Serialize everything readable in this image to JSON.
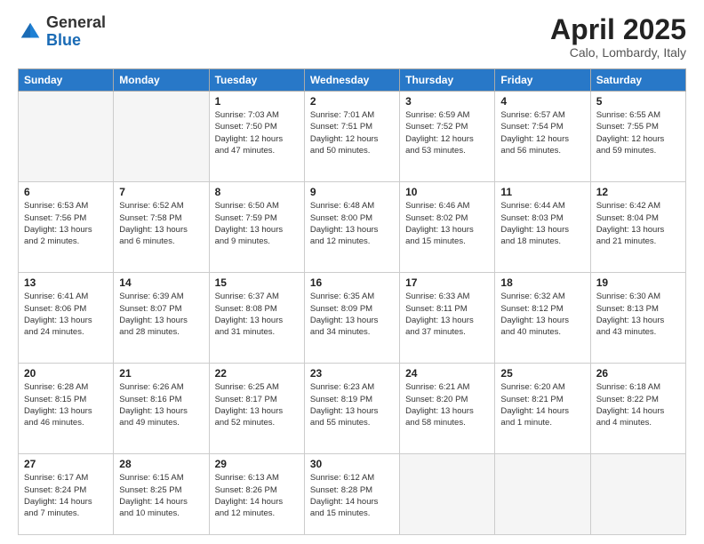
{
  "header": {
    "logo_general": "General",
    "logo_blue": "Blue",
    "title": "April 2025",
    "subtitle": "Calo, Lombardy, Italy"
  },
  "days_of_week": [
    "Sunday",
    "Monday",
    "Tuesday",
    "Wednesday",
    "Thursday",
    "Friday",
    "Saturday"
  ],
  "weeks": [
    [
      {
        "day": "",
        "info": ""
      },
      {
        "day": "",
        "info": ""
      },
      {
        "day": "1",
        "info": "Sunrise: 7:03 AM\nSunset: 7:50 PM\nDaylight: 12 hours and 47 minutes."
      },
      {
        "day": "2",
        "info": "Sunrise: 7:01 AM\nSunset: 7:51 PM\nDaylight: 12 hours and 50 minutes."
      },
      {
        "day": "3",
        "info": "Sunrise: 6:59 AM\nSunset: 7:52 PM\nDaylight: 12 hours and 53 minutes."
      },
      {
        "day": "4",
        "info": "Sunrise: 6:57 AM\nSunset: 7:54 PM\nDaylight: 12 hours and 56 minutes."
      },
      {
        "day": "5",
        "info": "Sunrise: 6:55 AM\nSunset: 7:55 PM\nDaylight: 12 hours and 59 minutes."
      }
    ],
    [
      {
        "day": "6",
        "info": "Sunrise: 6:53 AM\nSunset: 7:56 PM\nDaylight: 13 hours and 2 minutes."
      },
      {
        "day": "7",
        "info": "Sunrise: 6:52 AM\nSunset: 7:58 PM\nDaylight: 13 hours and 6 minutes."
      },
      {
        "day": "8",
        "info": "Sunrise: 6:50 AM\nSunset: 7:59 PM\nDaylight: 13 hours and 9 minutes."
      },
      {
        "day": "9",
        "info": "Sunrise: 6:48 AM\nSunset: 8:00 PM\nDaylight: 13 hours and 12 minutes."
      },
      {
        "day": "10",
        "info": "Sunrise: 6:46 AM\nSunset: 8:02 PM\nDaylight: 13 hours and 15 minutes."
      },
      {
        "day": "11",
        "info": "Sunrise: 6:44 AM\nSunset: 8:03 PM\nDaylight: 13 hours and 18 minutes."
      },
      {
        "day": "12",
        "info": "Sunrise: 6:42 AM\nSunset: 8:04 PM\nDaylight: 13 hours and 21 minutes."
      }
    ],
    [
      {
        "day": "13",
        "info": "Sunrise: 6:41 AM\nSunset: 8:06 PM\nDaylight: 13 hours and 24 minutes."
      },
      {
        "day": "14",
        "info": "Sunrise: 6:39 AM\nSunset: 8:07 PM\nDaylight: 13 hours and 28 minutes."
      },
      {
        "day": "15",
        "info": "Sunrise: 6:37 AM\nSunset: 8:08 PM\nDaylight: 13 hours and 31 minutes."
      },
      {
        "day": "16",
        "info": "Sunrise: 6:35 AM\nSunset: 8:09 PM\nDaylight: 13 hours and 34 minutes."
      },
      {
        "day": "17",
        "info": "Sunrise: 6:33 AM\nSunset: 8:11 PM\nDaylight: 13 hours and 37 minutes."
      },
      {
        "day": "18",
        "info": "Sunrise: 6:32 AM\nSunset: 8:12 PM\nDaylight: 13 hours and 40 minutes."
      },
      {
        "day": "19",
        "info": "Sunrise: 6:30 AM\nSunset: 8:13 PM\nDaylight: 13 hours and 43 minutes."
      }
    ],
    [
      {
        "day": "20",
        "info": "Sunrise: 6:28 AM\nSunset: 8:15 PM\nDaylight: 13 hours and 46 minutes."
      },
      {
        "day": "21",
        "info": "Sunrise: 6:26 AM\nSunset: 8:16 PM\nDaylight: 13 hours and 49 minutes."
      },
      {
        "day": "22",
        "info": "Sunrise: 6:25 AM\nSunset: 8:17 PM\nDaylight: 13 hours and 52 minutes."
      },
      {
        "day": "23",
        "info": "Sunrise: 6:23 AM\nSunset: 8:19 PM\nDaylight: 13 hours and 55 minutes."
      },
      {
        "day": "24",
        "info": "Sunrise: 6:21 AM\nSunset: 8:20 PM\nDaylight: 13 hours and 58 minutes."
      },
      {
        "day": "25",
        "info": "Sunrise: 6:20 AM\nSunset: 8:21 PM\nDaylight: 14 hours and 1 minute."
      },
      {
        "day": "26",
        "info": "Sunrise: 6:18 AM\nSunset: 8:22 PM\nDaylight: 14 hours and 4 minutes."
      }
    ],
    [
      {
        "day": "27",
        "info": "Sunrise: 6:17 AM\nSunset: 8:24 PM\nDaylight: 14 hours and 7 minutes."
      },
      {
        "day": "28",
        "info": "Sunrise: 6:15 AM\nSunset: 8:25 PM\nDaylight: 14 hours and 10 minutes."
      },
      {
        "day": "29",
        "info": "Sunrise: 6:13 AM\nSunset: 8:26 PM\nDaylight: 14 hours and 12 minutes."
      },
      {
        "day": "30",
        "info": "Sunrise: 6:12 AM\nSunset: 8:28 PM\nDaylight: 14 hours and 15 minutes."
      },
      {
        "day": "",
        "info": ""
      },
      {
        "day": "",
        "info": ""
      },
      {
        "day": "",
        "info": ""
      }
    ]
  ]
}
